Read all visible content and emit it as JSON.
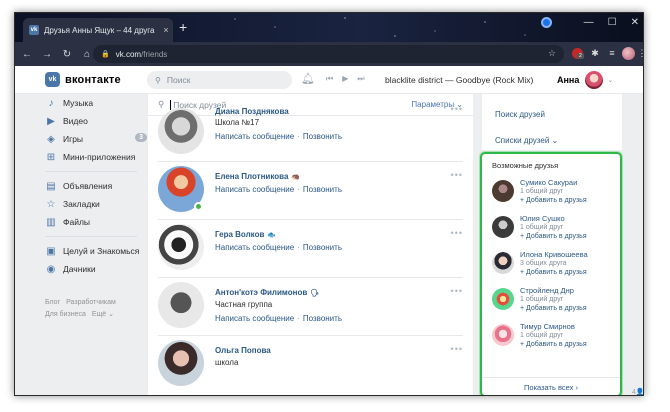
{
  "browser": {
    "tab_title": "Друзья Анны Ящук – 44 друга",
    "tab_close": "×",
    "new_tab": "+",
    "url_host": "vk.com",
    "url_path": "/friends",
    "ext_badge": "2"
  },
  "vk": {
    "logo_mark": "vk",
    "logo_text": "вконтакте",
    "search_placeholder": "Поиск",
    "now_playing": "blacklite district — Goodbye (Rock Mix)",
    "user_name": "Анна"
  },
  "leftnav": {
    "items": [
      {
        "label": "Музыка",
        "icon": "music-icon",
        "glyph": "♪"
      },
      {
        "label": "Видео",
        "icon": "video-icon",
        "glyph": "▶"
      },
      {
        "label": "Игры",
        "icon": "games-icon",
        "glyph": "◈",
        "badge": "3"
      },
      {
        "label": "Мини-приложения",
        "icon": "apps-icon",
        "glyph": "⊞"
      },
      {
        "label": "Объявления",
        "icon": "ads-icon",
        "glyph": "▤"
      },
      {
        "label": "Закладки",
        "icon": "bookmark-icon",
        "glyph": "☆"
      },
      {
        "label": "Файлы",
        "icon": "files-icon",
        "glyph": "▥"
      },
      {
        "label": "Целуй и Знакомься",
        "icon": "briefcase-icon",
        "glyph": "▣"
      },
      {
        "label": "Дачники",
        "icon": "gamepad-icon",
        "glyph": "◉"
      }
    ],
    "footer": {
      "blog": "Блог",
      "developers": "Разработчикам",
      "business": "Для бизнеса",
      "more": "Ещё ⌄"
    }
  },
  "friends": {
    "search_placeholder": "Поиск друзей",
    "params_label": "Параметры ⌄",
    "write_label": "Написать сообщение",
    "call_label": "Позвонить",
    "more_label": "•••",
    "list": [
      {
        "name": "Диана Позднякова",
        "sub": "Школа №17"
      },
      {
        "name": "Елена Плотникова",
        "sub": "",
        "emoji": "🦔"
      },
      {
        "name": "Гера Волков",
        "sub": "",
        "emoji": "🐟"
      },
      {
        "name": "Антон'котэ Филимонов",
        "sub": "Частная группа",
        "emoji": "🗣"
      },
      {
        "name": "Ольга Попова",
        "sub": "школа"
      }
    ]
  },
  "right": {
    "find_friends": "Поиск друзей",
    "friend_lists": "Списки друзей ⌄",
    "suggest_title": "Возможные друзья",
    "add_label": "+ Добавить в друзья",
    "show_all": "Показать всех ›",
    "suggestions": [
      {
        "name": "Сумико Сакураи",
        "mutual": "1 общий друг"
      },
      {
        "name": "Юлия Сушко",
        "mutual": "1 общий друг"
      },
      {
        "name": "Илона Кривошеева",
        "mutual": "3 общих друга"
      },
      {
        "name": "Стройленд Днр",
        "mutual": "1 общий друг"
      },
      {
        "name": "Тимур Смирнов",
        "mutual": "1 общий друг"
      }
    ]
  },
  "colors": {
    "accent": "#4a76a8",
    "link": "#2a5885",
    "highlight": "#2fb84a",
    "online": "#4bb34b"
  }
}
